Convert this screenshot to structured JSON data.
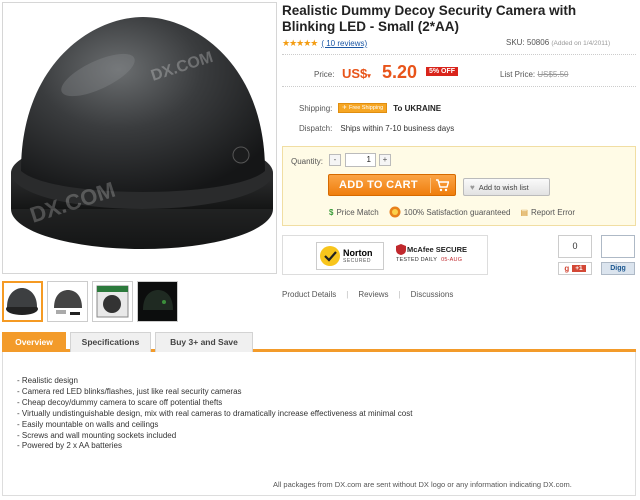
{
  "product": {
    "title": "Realistic Dummy Decoy Security Camera with Blinking LED - Small (2*AA)",
    "stars": "★★★★★",
    "reviews_text": "( 10 reviews)",
    "sku_text": "SKU: 50806",
    "added_text": "(Added on 1/4/2011)",
    "watermark": "DX.COM"
  },
  "price": {
    "label": "Price:",
    "currency": "US$",
    "value": "5.20",
    "discount_badge": "5% OFF",
    "list_label": "List Price:",
    "list_value": "US$5.50"
  },
  "shipping": {
    "label": "Shipping:",
    "badge": "Free Shipping",
    "destination": "To UKRAINE",
    "dispatch_label": "Dispatch:",
    "dispatch_value": "Ships within 7-10 business days"
  },
  "buy": {
    "qty_label": "Quantity:",
    "qty_minus": "-",
    "qty_plus": "+",
    "qty_value": "1",
    "add_to_cart": "ADD TO CART",
    "wishlist": "Add to wish list",
    "price_match": "Price Match",
    "satisfaction": "100% Satisfaction guaranteed",
    "report_error": "Report Error"
  },
  "security": {
    "norton_title": "Norton",
    "norton_sub": "SECURED",
    "mcafee_title": "McAfee SECURE",
    "mcafee_sub": "TESTED DAILY",
    "mcafee_date": "05-AUG"
  },
  "social": {
    "gplus_count": "0",
    "gplus_label": "+1",
    "digg_count": "",
    "digg_label": "Digg"
  },
  "links": {
    "details": "Product Details",
    "reviews": "Reviews",
    "discussions": "Discussions",
    "separator": "|"
  },
  "tabs": [
    {
      "label": "Overview"
    },
    {
      "label": "Specifications"
    },
    {
      "label": "Buy 3+ and Save"
    }
  ],
  "features": [
    "- Realistic design",
    "- Camera red LED blinks/flashes, just like real security cameras",
    "- Cheap decoy/dummy camera to scare off potential thefts",
    "- Virtually undistinguishable design, mix with real cameras to dramatically increase effectiveness at minimal cost",
    "- Easily mountable on walls and ceilings",
    "- Screws and wall mounting sockets included",
    "- Powered by 2 x AA batteries"
  ],
  "footer_note": "All packages from DX.com are sent without DX logo or any information indicating DX.com.",
  "colors": {
    "accent": "#f39b2a",
    "price": "#e8541a",
    "badge": "#d9241b",
    "link": "#1a56a4"
  },
  "icons": [
    "free-shipping-icon",
    "cart-icon",
    "heart-icon",
    "price-match-icon",
    "satisfaction-icon",
    "report-icon",
    "norton-check-icon",
    "mcafee-shield-icon",
    "google-icon"
  ]
}
